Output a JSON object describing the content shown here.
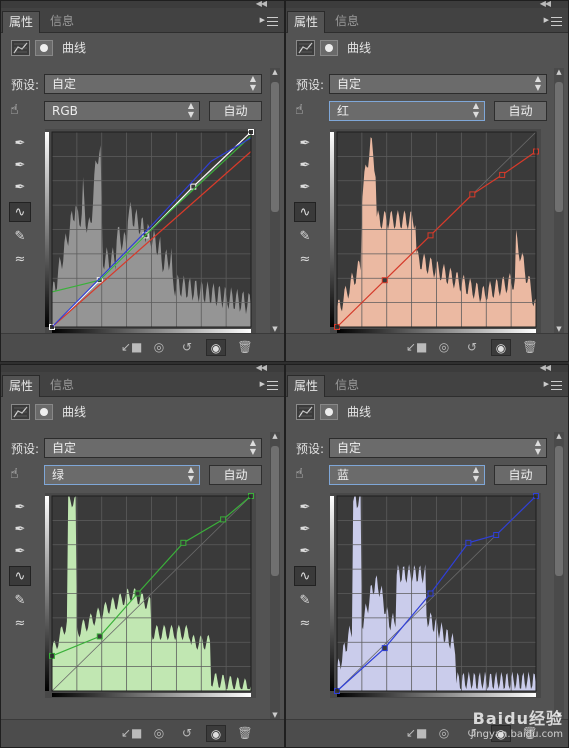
{
  "panels": [
    {
      "tab_properties": "属性",
      "tab_info": "信息",
      "title": "曲线",
      "preset_label": "预设:",
      "preset_value": "自定",
      "channel": "RGB",
      "auto_label": "自动"
    },
    {
      "tab_properties": "属性",
      "tab_info": "信息",
      "title": "曲线",
      "preset_label": "预设:",
      "preset_value": "自定",
      "channel": "红",
      "auto_label": "自动"
    },
    {
      "tab_properties": "属性",
      "tab_info": "信息",
      "title": "曲线",
      "preset_label": "预设:",
      "preset_value": "自定",
      "channel": "绿",
      "auto_label": "自动"
    },
    {
      "tab_properties": "属性",
      "tab_info": "信息",
      "title": "曲线",
      "preset_label": "预设:",
      "preset_value": "自定",
      "channel": "蓝",
      "auto_label": "自动"
    }
  ],
  "colors": {
    "panel_bg": "#535353",
    "graph_bg": "#3a3a3a",
    "rgb_hist": "#9a9a9a",
    "red_hist": "#f4c0a8",
    "green_hist": "#c8f0b8",
    "blue_hist": "#d2d4f4",
    "red_curve": "#d83a2a",
    "green_curve": "#3ab03a",
    "blue_curve": "#2f3fd8",
    "select_highlight": "#7fa7d8"
  },
  "icons": [
    "curves-icon",
    "mask-icon",
    "hand-target-icon",
    "black-eyedropper-icon",
    "gray-eyedropper-icon",
    "white-eyedropper-icon",
    "curve-tool-icon",
    "pencil-icon",
    "smooth-icon",
    "clip-to-layer-icon",
    "view-previous-icon",
    "reset-icon",
    "visibility-eye-icon",
    "trash-icon"
  ],
  "watermark": {
    "brand": "Baidu经验",
    "url": "jingyan.baidu.com"
  }
}
